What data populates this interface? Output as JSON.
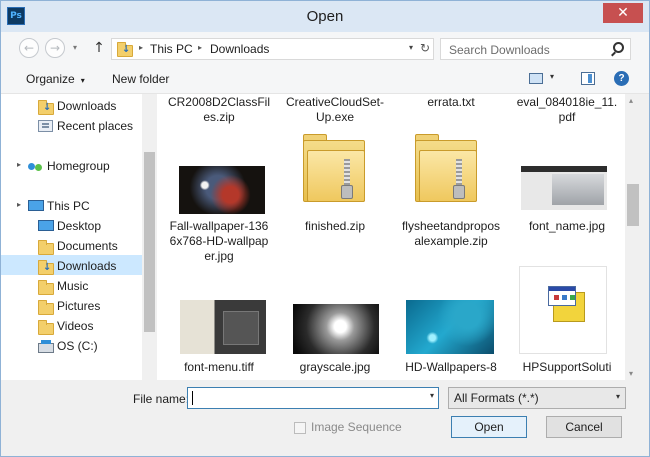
{
  "window": {
    "title": "Open",
    "app_icon_text": "Ps",
    "close_glyph": "✕"
  },
  "nav": {
    "back_glyph": "←",
    "forward_glyph": "→",
    "recent_glyph": "▾",
    "up_glyph": "↑",
    "breadcrumb": [
      "This PC",
      "Downloads"
    ],
    "crumb_sep": "▸",
    "dropdown_glyph": "▾",
    "refresh_glyph": "↻",
    "search_placeholder": "Search Downloads"
  },
  "toolbar": {
    "organize_label": "Organize",
    "organize_caret": "▾",
    "new_folder_label": "New folder",
    "view_caret": "▾",
    "help_glyph": "?"
  },
  "sidebar": {
    "expand_glyph": "▸",
    "items": [
      {
        "label": "Downloads"
      },
      {
        "label": "Recent places"
      },
      {
        "label": "Homegroup"
      },
      {
        "label": "This PC"
      },
      {
        "label": "Desktop"
      },
      {
        "label": "Documents"
      },
      {
        "label": "Downloads"
      },
      {
        "label": "Music"
      },
      {
        "label": "Pictures"
      },
      {
        "label": "Videos"
      },
      {
        "label": "OS (C:)"
      }
    ]
  },
  "files": {
    "row0": [
      "CR2008D2ClassFiles.zip",
      "CreativeCloudSet-Up.exe",
      "errata.txt",
      "eval_084018ie_11.pdf"
    ],
    "row1": [
      "Fall-wallpaper-1366x768-HD-wallpaper.jpg",
      "finished.zip",
      "flysheetandproposalexample.zip",
      "font_name.jpg"
    ],
    "row2": [
      "font-menu.tiff",
      "grayscale.jpg",
      "HD-Wallpapers-8",
      "HPSupportSoluti"
    ]
  },
  "content_scroll": {
    "up_glyph": "▴",
    "down_glyph": "▾"
  },
  "bottom": {
    "filename_label": "File name:",
    "filename_value": "",
    "filename_dd": "▾",
    "format_value": "All Formats (*.*)",
    "format_dd": "▾",
    "sequence_label": "Image Sequence",
    "open_label": "Open",
    "cancel_label": "Cancel"
  }
}
